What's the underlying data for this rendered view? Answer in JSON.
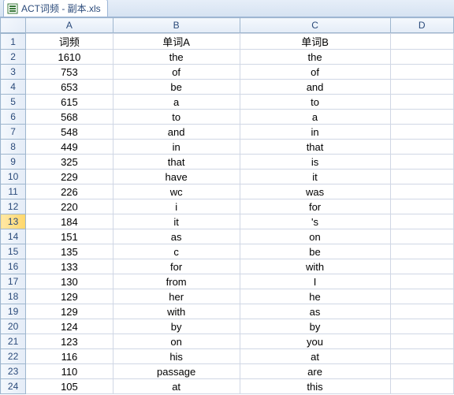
{
  "tab": {
    "title": "ACT词频 - 副本.xls"
  },
  "columns": [
    "A",
    "B",
    "C",
    "D"
  ],
  "headers": {
    "A": "词频",
    "B": "单词A",
    "C": "单词B"
  },
  "selected_row": 13,
  "chart_data": {
    "type": "table",
    "title": "ACT词频 - 副本.xls",
    "columns": [
      "词频",
      "单词A",
      "单词B"
    ],
    "rows": [
      [
        "1610",
        "the",
        "the"
      ],
      [
        "753",
        "of",
        "of"
      ],
      [
        "653",
        "be",
        "and"
      ],
      [
        "615",
        "a",
        "to"
      ],
      [
        "568",
        "to",
        "a"
      ],
      [
        "548",
        "and",
        "in"
      ],
      [
        "449",
        "in",
        "that"
      ],
      [
        "325",
        "that",
        "is"
      ],
      [
        "229",
        "have",
        "it"
      ],
      [
        "226",
        "wc",
        "was"
      ],
      [
        "220",
        "i",
        "for"
      ],
      [
        "184",
        "it",
        "'s"
      ],
      [
        "151",
        "as",
        "on"
      ],
      [
        "135",
        "c",
        "be"
      ],
      [
        "133",
        "for",
        "with"
      ],
      [
        "130",
        "from",
        "I"
      ],
      [
        "129",
        "her",
        "he"
      ],
      [
        "129",
        "with",
        "as"
      ],
      [
        "124",
        "by",
        "by"
      ],
      [
        "123",
        "on",
        "you"
      ],
      [
        "116",
        "his",
        "at"
      ],
      [
        "110",
        "passage",
        "are"
      ],
      [
        "105",
        "at",
        "this"
      ]
    ]
  }
}
